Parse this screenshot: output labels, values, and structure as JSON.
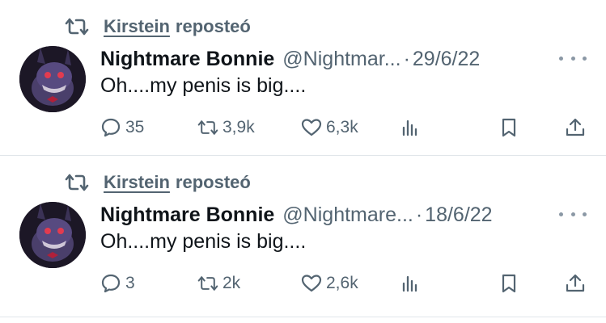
{
  "tweets": [
    {
      "repost_user": "Kirstein",
      "repost_suffix": "reposteó",
      "display_name": "Nightmare Bonnie",
      "handle": "@Nightmar...",
      "separator": "·",
      "date": "29/6/22",
      "text": "Oh....my penis is big....",
      "replies": "35",
      "reposts": "3,9k",
      "likes": "6,3k"
    },
    {
      "repost_user": "Kirstein",
      "repost_suffix": "reposteó",
      "display_name": "Nightmare Bonnie",
      "handle": "@Nightmare...",
      "separator": "·",
      "date": "18/6/22",
      "text": "Oh....my penis is big....",
      "replies": "3",
      "reposts": "2k",
      "likes": "2,6k"
    }
  ],
  "icons": {
    "repost": "repost-icon",
    "reply": "reply-icon",
    "like": "heart-icon",
    "views": "views-icon",
    "bookmark": "bookmark-icon",
    "share": "share-icon",
    "more": "more-icon"
  },
  "colors": {
    "text_primary": "#0f1419",
    "text_secondary": "#536471",
    "divider": "#e1e6ea"
  }
}
